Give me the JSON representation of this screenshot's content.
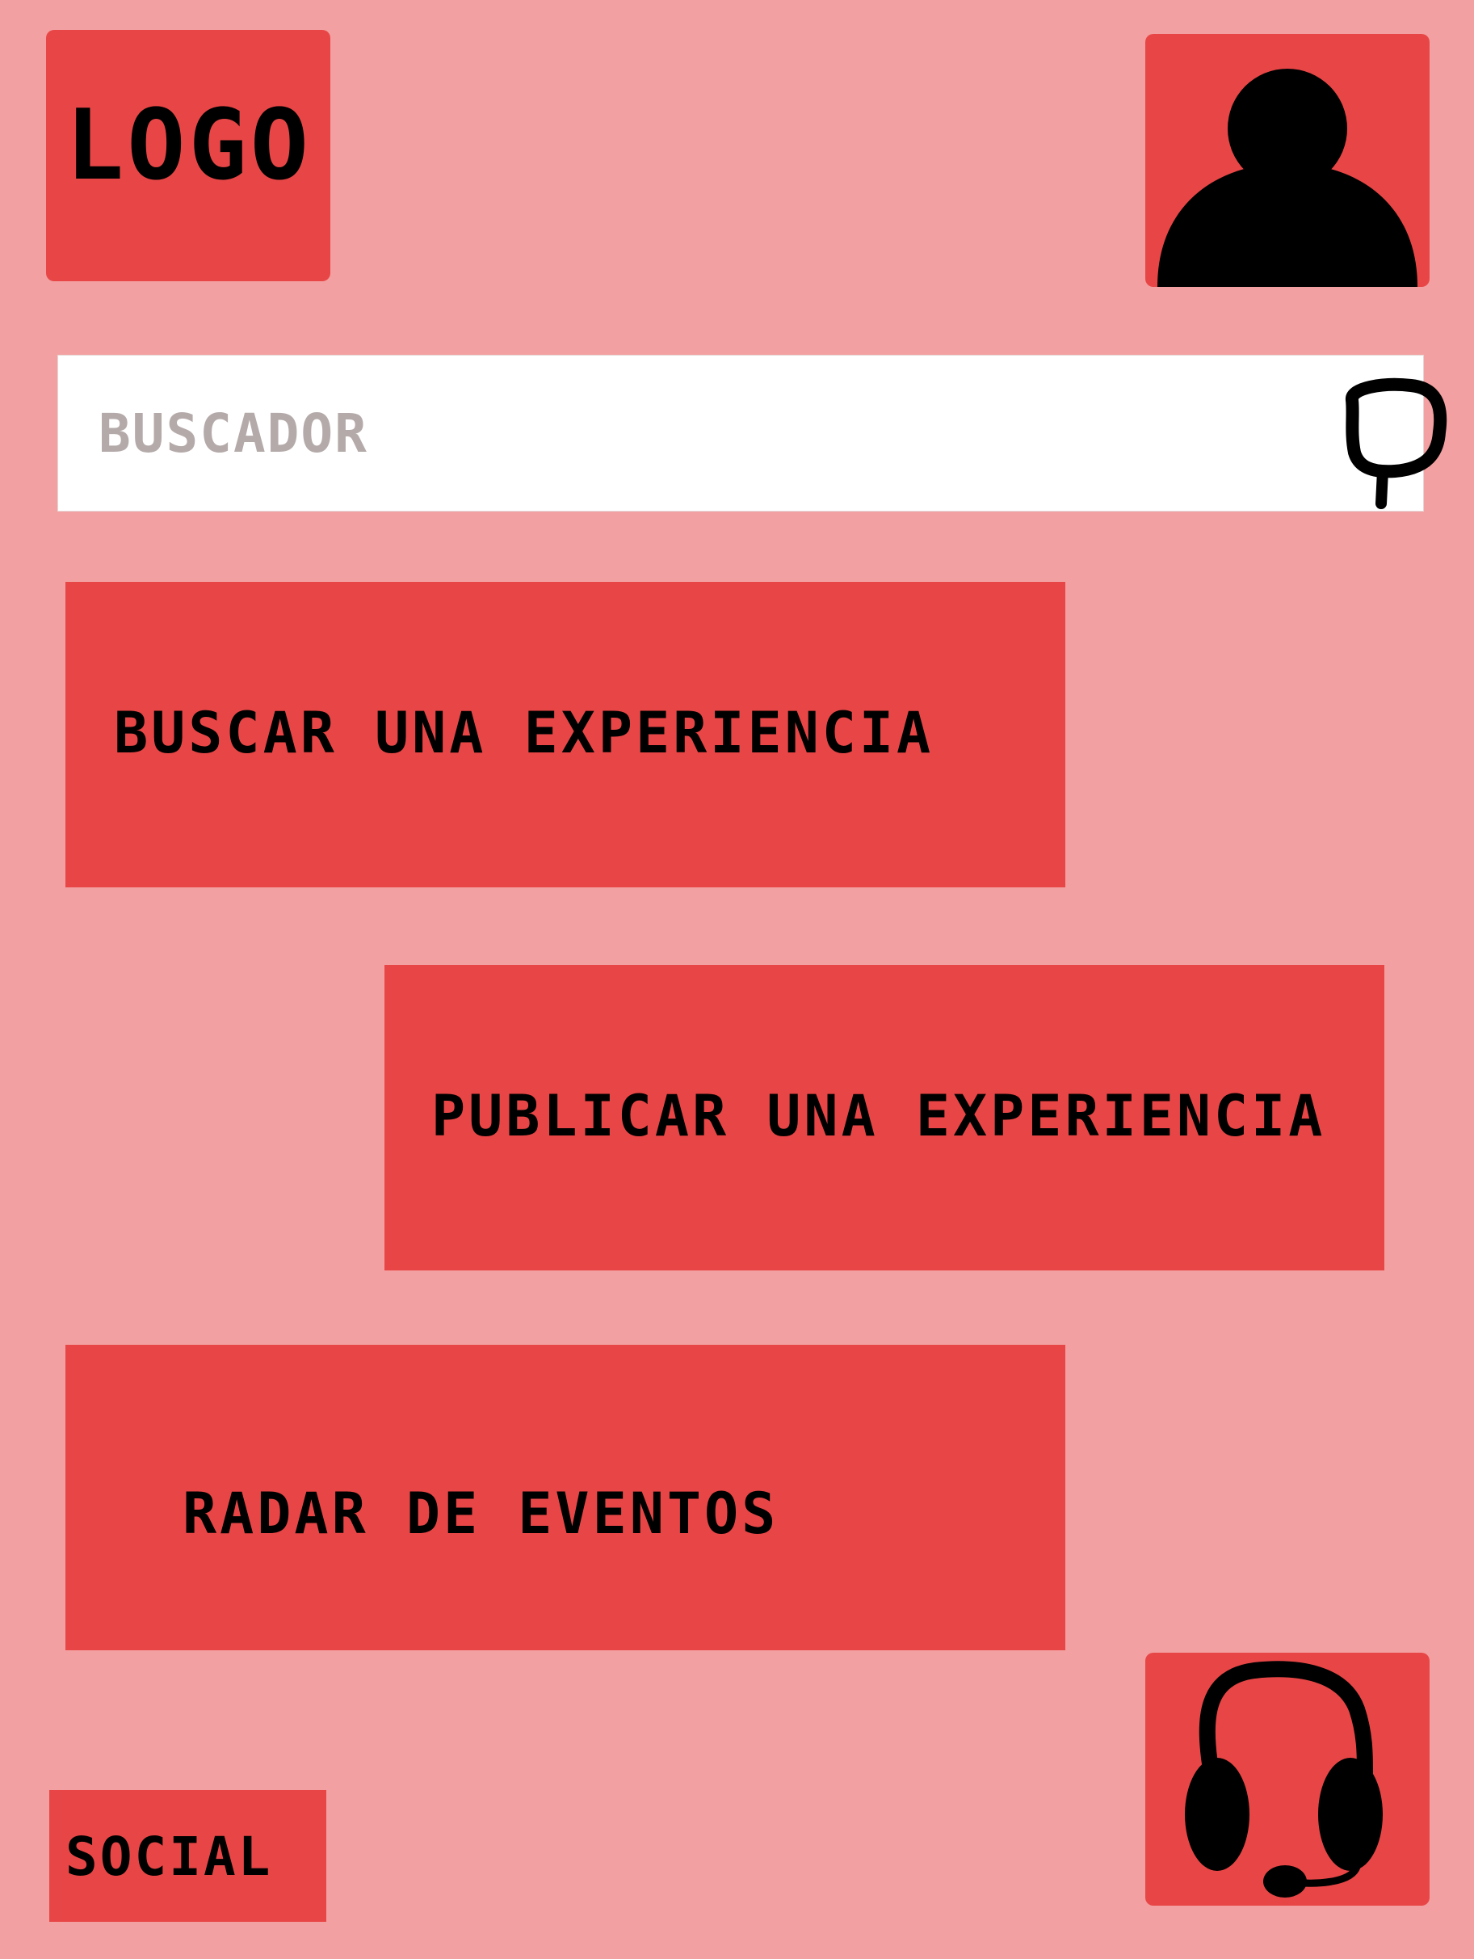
{
  "header": {
    "logo_text": "LOGO",
    "profile_icon": "user-avatar-icon"
  },
  "search": {
    "placeholder": "BUSCADOR",
    "value": "",
    "icon": "search-icon"
  },
  "menu": {
    "items": [
      {
        "label": "BUSCAR UNA EXPERIENCIA"
      },
      {
        "label": "PUBLICAR UNA EXPERIENCIA"
      },
      {
        "label": "RADAR DE EVENTOS"
      }
    ]
  },
  "footer": {
    "social_label": "SOCIAL",
    "support_icon": "headphones-icon"
  },
  "colors": {
    "background": "#f2a0a1",
    "accent": "#e84646",
    "text": "#000000",
    "search_bg": "#ffffff",
    "placeholder": "#b5aaaa"
  }
}
